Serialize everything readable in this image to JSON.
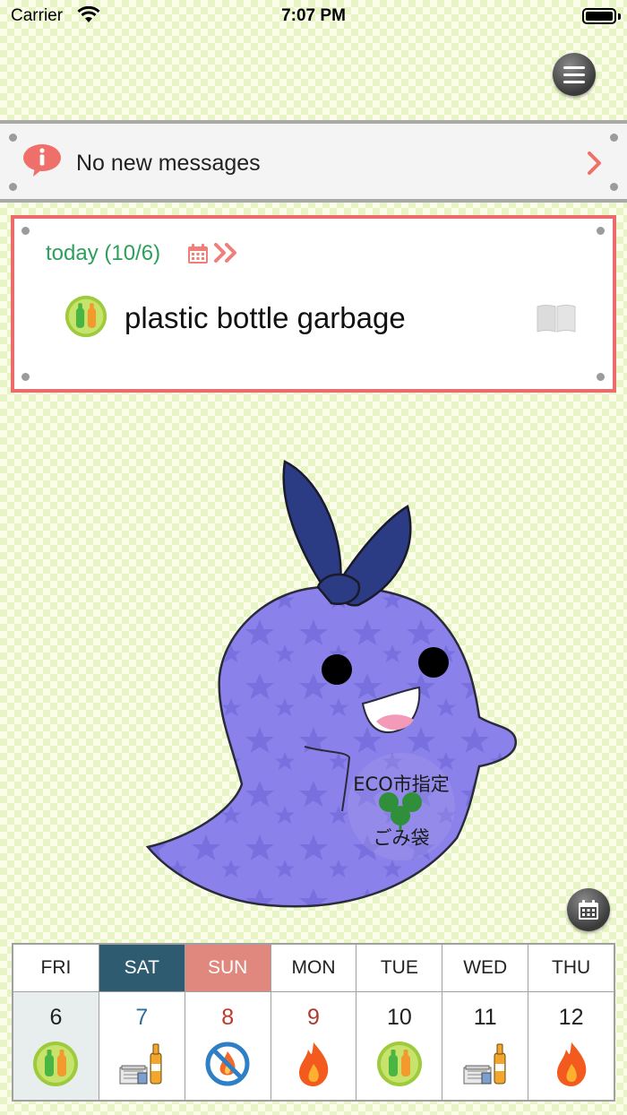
{
  "status_bar": {
    "carrier": "Carrier",
    "time": "7:07 PM"
  },
  "messages": {
    "text": "No new messages"
  },
  "today": {
    "label": "today (10/6)",
    "garbage": "plastic bottle garbage"
  },
  "mascot": {
    "badge_top": "ECO市指定",
    "badge_bottom": "ごみ袋"
  },
  "week": [
    {
      "day": "FRI",
      "date": "6",
      "type": "plastic-bottle-icon"
    },
    {
      "day": "SAT",
      "date": "7",
      "type": "recyclables-icon"
    },
    {
      "day": "SUN",
      "date": "8",
      "type": "no-collection-icon"
    },
    {
      "day": "MON",
      "date": "9",
      "type": "burnable-icon"
    },
    {
      "day": "TUE",
      "date": "10",
      "type": "plastic-bottle-icon"
    },
    {
      "day": "WED",
      "date": "11",
      "type": "recyclables-icon"
    },
    {
      "day": "THU",
      "date": "12",
      "type": "burnable-icon"
    }
  ],
  "colors": {
    "accent_red": "#ec6b6b",
    "today_green": "#2ba05a",
    "saturday": "#2e5b70",
    "sunday": "#e0887e"
  }
}
